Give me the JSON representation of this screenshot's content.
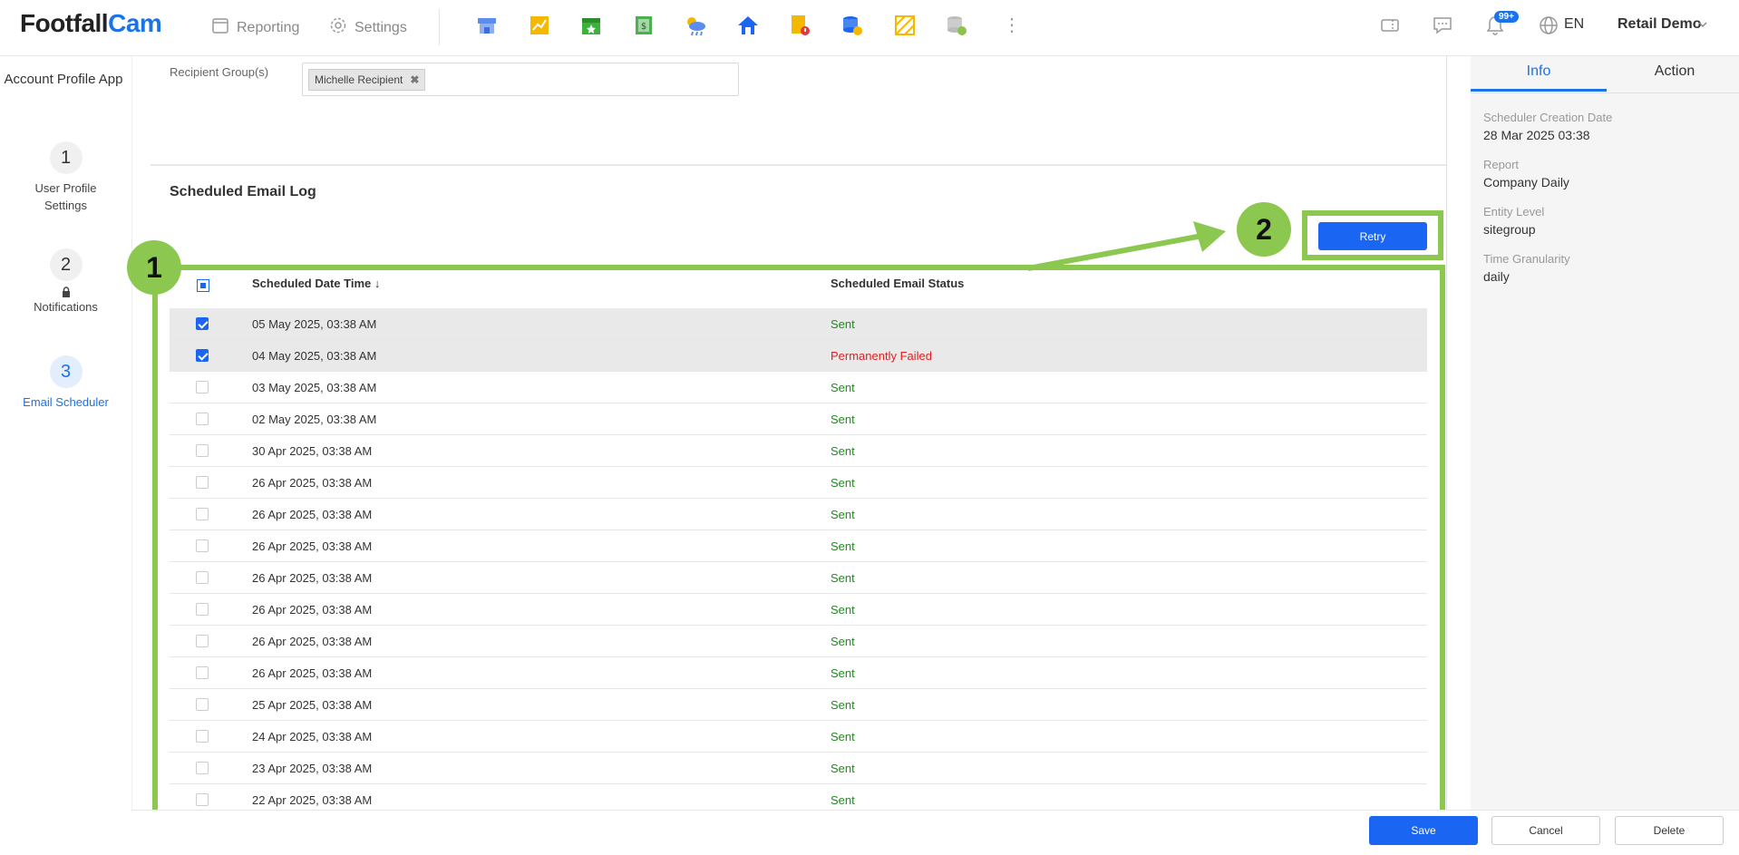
{
  "header": {
    "logo_part1": "Footfall",
    "logo_part2": "Cam",
    "nav_reporting": "Reporting",
    "nav_settings": "Settings",
    "notification_badge": "99+",
    "language": "EN",
    "user": "Retail Demo"
  },
  "left_nav": {
    "title": "Account Profile App",
    "steps": [
      {
        "num": "1",
        "label": "User Profile Settings"
      },
      {
        "num": "2",
        "label": "Notifications"
      },
      {
        "num": "3",
        "label": "Email Scheduler"
      }
    ]
  },
  "form": {
    "recipient_label": "Recipient Group(s)",
    "recipient_chip": "Michelle Recipient",
    "chip_remove": "✖"
  },
  "log": {
    "title": "Scheduled Email Log",
    "retry_label": "Retry",
    "col_date": "Scheduled Date Time ↓",
    "col_status": "Scheduled Email Status",
    "rows": [
      {
        "date": "05 May 2025, 03:38 AM",
        "status": "Sent"
      },
      {
        "date": "04 May 2025, 03:38 AM",
        "status": "Permanently Failed"
      },
      {
        "date": "03 May 2025, 03:38 AM",
        "status": "Sent"
      },
      {
        "date": "02 May 2025, 03:38 AM",
        "status": "Sent"
      },
      {
        "date": "30 Apr 2025, 03:38 AM",
        "status": "Sent"
      },
      {
        "date": "26 Apr 2025, 03:38 AM",
        "status": "Sent"
      },
      {
        "date": "26 Apr 2025, 03:38 AM",
        "status": "Sent"
      },
      {
        "date": "26 Apr 2025, 03:38 AM",
        "status": "Sent"
      },
      {
        "date": "26 Apr 2025, 03:38 AM",
        "status": "Sent"
      },
      {
        "date": "26 Apr 2025, 03:38 AM",
        "status": "Sent"
      },
      {
        "date": "26 Apr 2025, 03:38 AM",
        "status": "Sent"
      },
      {
        "date": "26 Apr 2025, 03:38 AM",
        "status": "Sent"
      },
      {
        "date": "25 Apr 2025, 03:38 AM",
        "status": "Sent"
      },
      {
        "date": "24 Apr 2025, 03:38 AM",
        "status": "Sent"
      },
      {
        "date": "23 Apr 2025, 03:38 AM",
        "status": "Sent"
      },
      {
        "date": "22 Apr 2025, 03:38 AM",
        "status": "Sent"
      }
    ]
  },
  "annotations": {
    "one": "1",
    "two": "2"
  },
  "side_panel": {
    "tab_info": "Info",
    "tab_action": "Action",
    "fields": [
      {
        "key": "Scheduler Creation Date",
        "value": "28 Mar 2025 03:38"
      },
      {
        "key": "Report",
        "value": "Company Daily"
      },
      {
        "key": "Entity Level",
        "value": "sitegroup"
      },
      {
        "key": "Time Granularity",
        "value": "daily"
      }
    ]
  },
  "footer": {
    "save": "Save",
    "cancel": "Cancel",
    "delete": "Delete"
  },
  "colors": {
    "accent": "#1a66f2",
    "highlight": "#8cc74f",
    "sent": "#1e8c1e",
    "failed": "#e02020"
  }
}
